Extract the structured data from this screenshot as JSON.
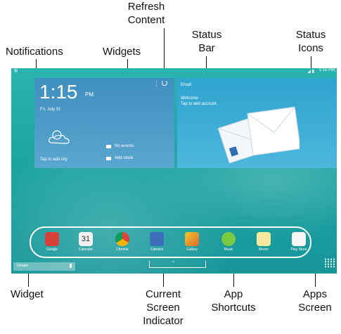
{
  "callouts": {
    "refresh_line1": "Refresh",
    "refresh_line2": "Content",
    "status_bar_line1": "Status",
    "status_bar_line2": "Bar",
    "status_icons_line1": "Status",
    "status_icons_line2": "Icons",
    "notifications": "Notifications",
    "widgets": "Widgets",
    "widget": "Widget",
    "current_line1": "Current",
    "current_line2": "Screen",
    "current_line3": "Indicator",
    "app_line1": "App",
    "app_line2": "Shortcuts",
    "apps_line1": "Apps",
    "apps_line2": "Screen"
  },
  "status_bar": {
    "time": "1:15 PM"
  },
  "clock_widget": {
    "time": "1:15",
    "ampm": "PM",
    "date": "Fri, July 31",
    "weather_prompt": "Tap to add city.",
    "events": "No events",
    "stock": "Add stock"
  },
  "email_widget": {
    "title": "Email",
    "welcome": "Welcome",
    "prompt": "Tap to add account."
  },
  "dock": {
    "apps": [
      {
        "label": "Google",
        "color": "#d8403a"
      },
      {
        "label": "Calendar",
        "color": "#f2f2f2"
      },
      {
        "label": "Chrome",
        "color": "#e8b43a"
      },
      {
        "label": "Camera",
        "color": "#3a6fb8"
      },
      {
        "label": "Gallery",
        "color": "#f0c830"
      },
      {
        "label": "Music",
        "color": "#7ac943"
      },
      {
        "label": "Memo",
        "color": "#f4e7a0"
      },
      {
        "label": "Play Store",
        "color": "#f5f5f5"
      }
    ],
    "calendar_day": "31"
  },
  "search_widget": {
    "text": "Google"
  }
}
